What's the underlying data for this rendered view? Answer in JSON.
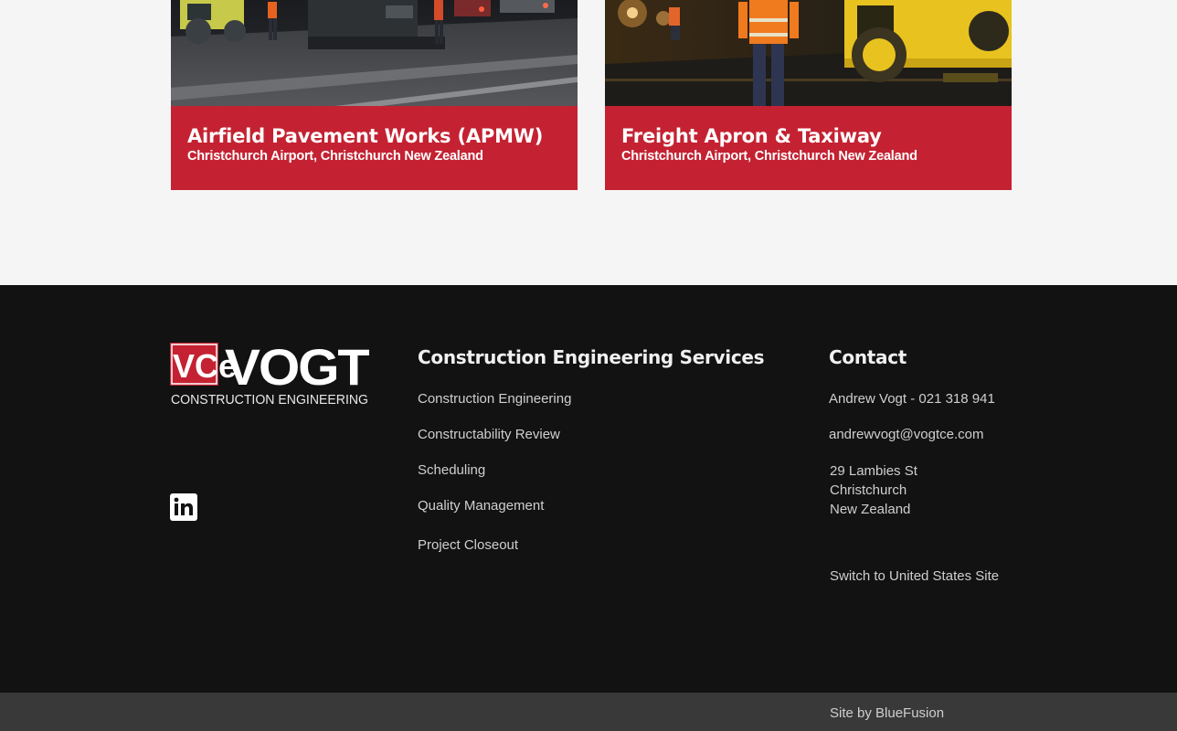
{
  "projects": [
    {
      "title": "Airfield Pavement Works (APMW)",
      "location": "Christchurch Airport, Christchurch New Zealand"
    },
    {
      "title": "Freight Apron & Taxiway",
      "location": "Christchurch Airport, Christchurch New Zealand"
    }
  ],
  "brand": {
    "logo_mark": "VCe",
    "logo_word": "VOGT",
    "logo_tagline": "CONSTRUCTION ENGINEERING",
    "accent_color": "#c42232"
  },
  "footer": {
    "social_icon": "linkedin-icon",
    "services": {
      "heading": "Construction Engineering Services",
      "items": [
        "Construction Engineering",
        "Constructability Review",
        "Scheduling",
        "Quality Management",
        "Project Closeout"
      ]
    },
    "contact": {
      "heading": "Contact",
      "phone": "Andrew Vogt - 021 318 941",
      "email": "andrewvogt@vogtce.com",
      "address": [
        "29 Lambies St",
        "Christchurch",
        "New Zealand"
      ],
      "switch_site": "Switch to United States Site"
    },
    "credit": "Site by BlueFusion"
  }
}
